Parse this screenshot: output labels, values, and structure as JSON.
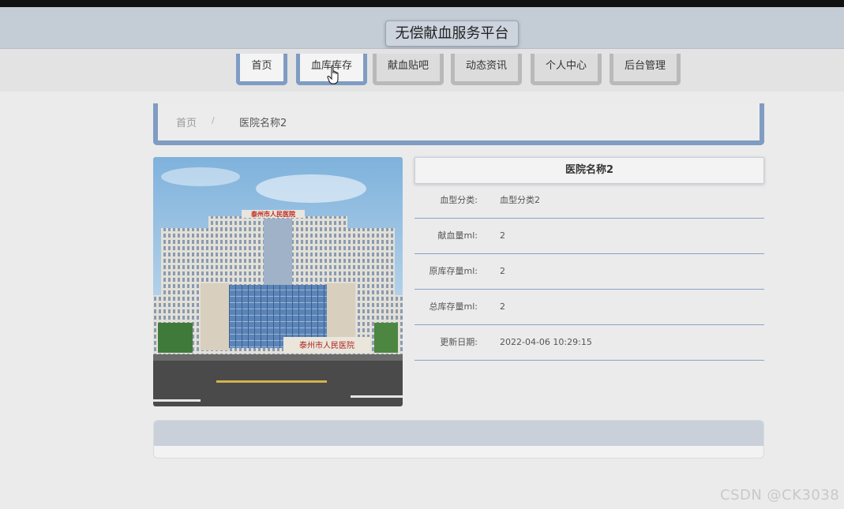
{
  "header": {
    "title": "无偿献血服务平台"
  },
  "nav": {
    "items": [
      {
        "label": "首页"
      },
      {
        "label": "血库库存"
      },
      {
        "label": "献血贴吧"
      },
      {
        "label": "动态资讯"
      },
      {
        "label": "个人中心"
      },
      {
        "label": "后台管理"
      }
    ]
  },
  "breadcrumb": {
    "home": "首页",
    "separator": "/",
    "current": "医院名称2"
  },
  "detail": {
    "title": "医院名称2",
    "fields": [
      {
        "label": "血型分类:",
        "value": "血型分类2"
      },
      {
        "label": "献血量ml:",
        "value": "2"
      },
      {
        "label": "原库存量ml:",
        "value": "2"
      },
      {
        "label": "总库存量ml:",
        "value": "2"
      },
      {
        "label": "更新日期:",
        "value": "2022-04-06 10:29:15"
      }
    ]
  },
  "photo": {
    "sign_text": "泰州市人民医院"
  },
  "watermark": "CSDN @CK3038",
  "colors": {
    "accent": "#7f9cc3",
    "header_bg": "#c4ccd6",
    "inactive_border": "#b9b9b9"
  }
}
